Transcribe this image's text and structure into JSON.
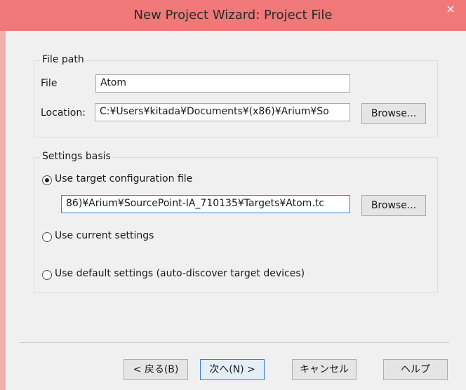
{
  "window": {
    "title": "New Project Wizard: Project File",
    "close_glyph": "×"
  },
  "file_path": {
    "group_label": "File path",
    "file_label": "File",
    "file_value": "Atom",
    "location_label": "Location:",
    "location_value": "C:¥Users¥kitada¥Documents¥(x86)¥Arium¥So",
    "browse_label": "Browse..."
  },
  "settings_basis": {
    "group_label": "Settings basis",
    "options": [
      {
        "label": "Use target configuration file",
        "checked": true
      },
      {
        "label": "Use current settings",
        "checked": false
      },
      {
        "label": "Use default settings (auto-discover target devices)",
        "checked": false
      }
    ],
    "config_path_value": "86)¥Arium¥SourcePoint-IA_710135¥Targets¥Atom.tc",
    "browse_label": "Browse..."
  },
  "footer": {
    "back_label": "< 戻る(B)",
    "next_label": "次へ(N) >",
    "cancel_label": "キャンセル",
    "help_label": "ヘルプ"
  }
}
